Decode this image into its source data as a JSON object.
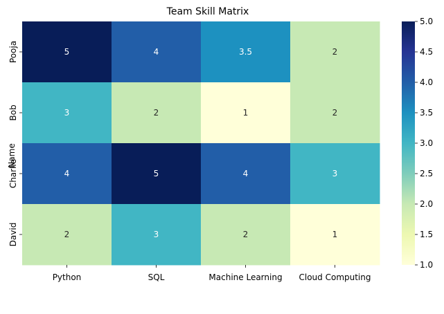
{
  "chart_data": {
    "type": "heatmap",
    "title": "Team Skill Matrix",
    "ylabel": "Name",
    "xlabel": "",
    "rows": [
      "Pooja",
      "Bob",
      "Charlie",
      "David"
    ],
    "columns": [
      "Python",
      "SQL",
      "Machine Learning",
      "Cloud Computing"
    ],
    "values": [
      [
        5,
        4,
        3.5,
        2
      ],
      [
        3,
        2,
        1,
        2
      ],
      [
        4,
        5,
        4,
        3
      ],
      [
        2,
        3,
        2,
        1
      ]
    ],
    "value_labels": [
      [
        "5",
        "4",
        "3.5",
        "2"
      ],
      [
        "3",
        "2",
        "1",
        "2"
      ],
      [
        "4",
        "5",
        "4",
        "3"
      ],
      [
        "2",
        "3",
        "2",
        "1"
      ]
    ],
    "colorbar": {
      "range": [
        1.0,
        5.0
      ],
      "ticks": [
        "1.0",
        "1.5",
        "2.0",
        "2.5",
        "3.0",
        "3.5",
        "4.0",
        "4.5",
        "5.0"
      ],
      "colormap": "YlGnBu"
    },
    "colors": {
      "light_text": "#ffffff",
      "dark_text": "#262626",
      "axis": "#000000"
    }
  }
}
